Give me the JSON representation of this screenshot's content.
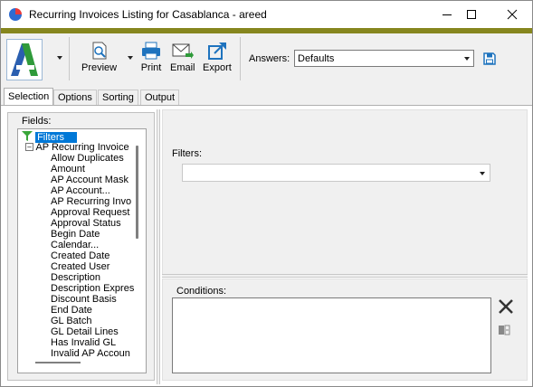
{
  "window": {
    "title": "Recurring Invoices Listing for Casablanca - areed"
  },
  "toolbar": {
    "preview_label": "Preview",
    "print_label": "Print",
    "email_label": "Email",
    "export_label": "Export",
    "answers_label": "Answers:",
    "answers_value": "Defaults"
  },
  "tabs": [
    {
      "label": "Selection"
    },
    {
      "label": "Options"
    },
    {
      "label": "Sorting"
    },
    {
      "label": "Output"
    }
  ],
  "fields_panel": {
    "label": "Fields:",
    "filters_node": "Filters",
    "group_node": "AP Recurring Invoice",
    "items": [
      "Allow Duplicates",
      "Amount",
      "AP Account Mask",
      "AP Account...",
      "AP Recurring Invo",
      "Approval Request",
      "Approval Status",
      "Begin Date",
      "Calendar...",
      "Created Date",
      "Created User",
      "Description",
      "Description Expres",
      "Discount Basis",
      "End Date",
      "GL Batch",
      "GL Detail Lines",
      "Has Invalid GL",
      "Invalid AP Accoun"
    ]
  },
  "filters_panel": {
    "label": "Filters:",
    "value": ""
  },
  "conditions_panel": {
    "label": "Conditions:"
  },
  "colors": {
    "accent_olive": "#86861e",
    "selection_blue": "#0078d7",
    "icon_blue": "#1e73be"
  }
}
